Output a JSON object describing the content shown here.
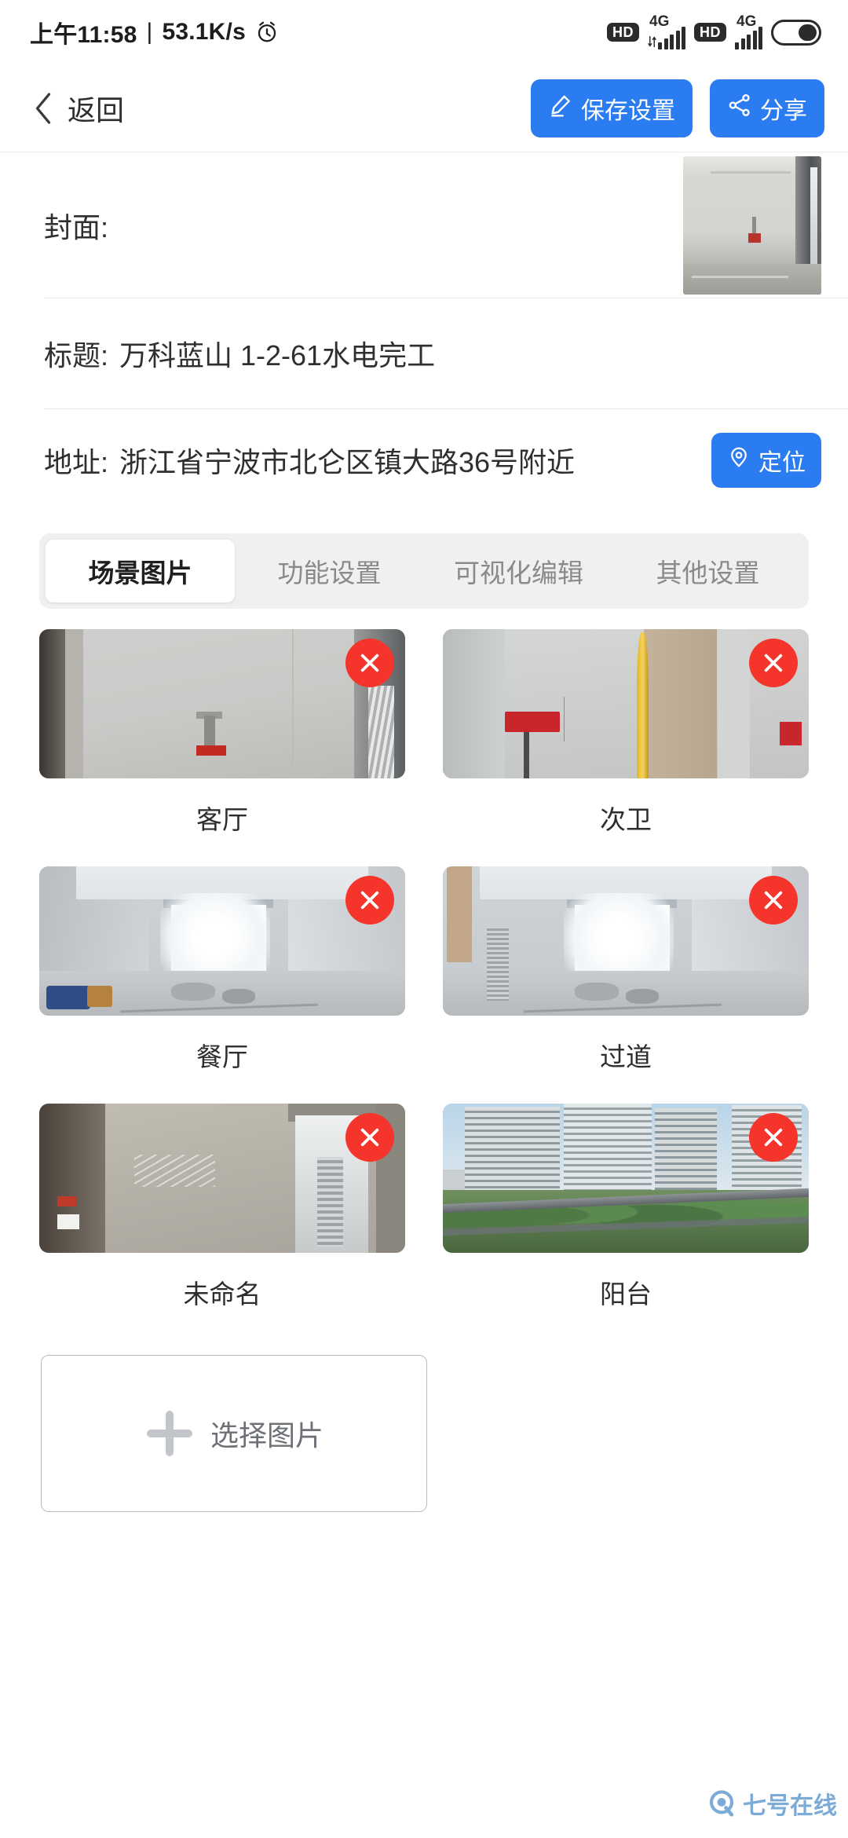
{
  "statusbar": {
    "time": "上午11:58",
    "separator": "|",
    "netspeed": "53.1K/s",
    "alarm_icon": "alarm-clock-icon",
    "hd1": "HD",
    "hd2": "HD",
    "net1": "4G",
    "net2": "4G",
    "battery_icon": "battery-icon"
  },
  "navbar": {
    "back_label": "返回",
    "save_label": "保存设置",
    "share_label": "分享"
  },
  "form": {
    "cover_label": "封面:",
    "title_label": "标题:",
    "title_value": "万科蓝山 1-2-61水电完工",
    "address_label": "地址:",
    "address_value": "浙江省宁波市北仑区镇大路36号附近",
    "locate_label": "定位"
  },
  "tabs": [
    {
      "label": "场景图片",
      "active": true
    },
    {
      "label": "功能设置",
      "active": false
    },
    {
      "label": "可视化编辑",
      "active": false
    },
    {
      "label": "其他设置",
      "active": false
    }
  ],
  "scenes": [
    {
      "caption": "客厅",
      "delete_icon": "close-icon"
    },
    {
      "caption": "次卫",
      "delete_icon": "close-icon"
    },
    {
      "caption": "餐厅",
      "delete_icon": "close-icon"
    },
    {
      "caption": "过道",
      "delete_icon": "close-icon"
    },
    {
      "caption": "未命名",
      "delete_icon": "close-icon"
    },
    {
      "caption": "阳台",
      "delete_icon": "close-icon"
    }
  ],
  "add_button": {
    "label": "选择图片",
    "icon": "plus-icon"
  },
  "watermark": {
    "text": "七号在线",
    "logo": "q-logo-icon"
  },
  "colors": {
    "accent_blue": "#2b7cf0",
    "delete_red": "#f5352b",
    "tab_bg": "#f0f0f0",
    "watermark_blue": "#74a7d4"
  }
}
